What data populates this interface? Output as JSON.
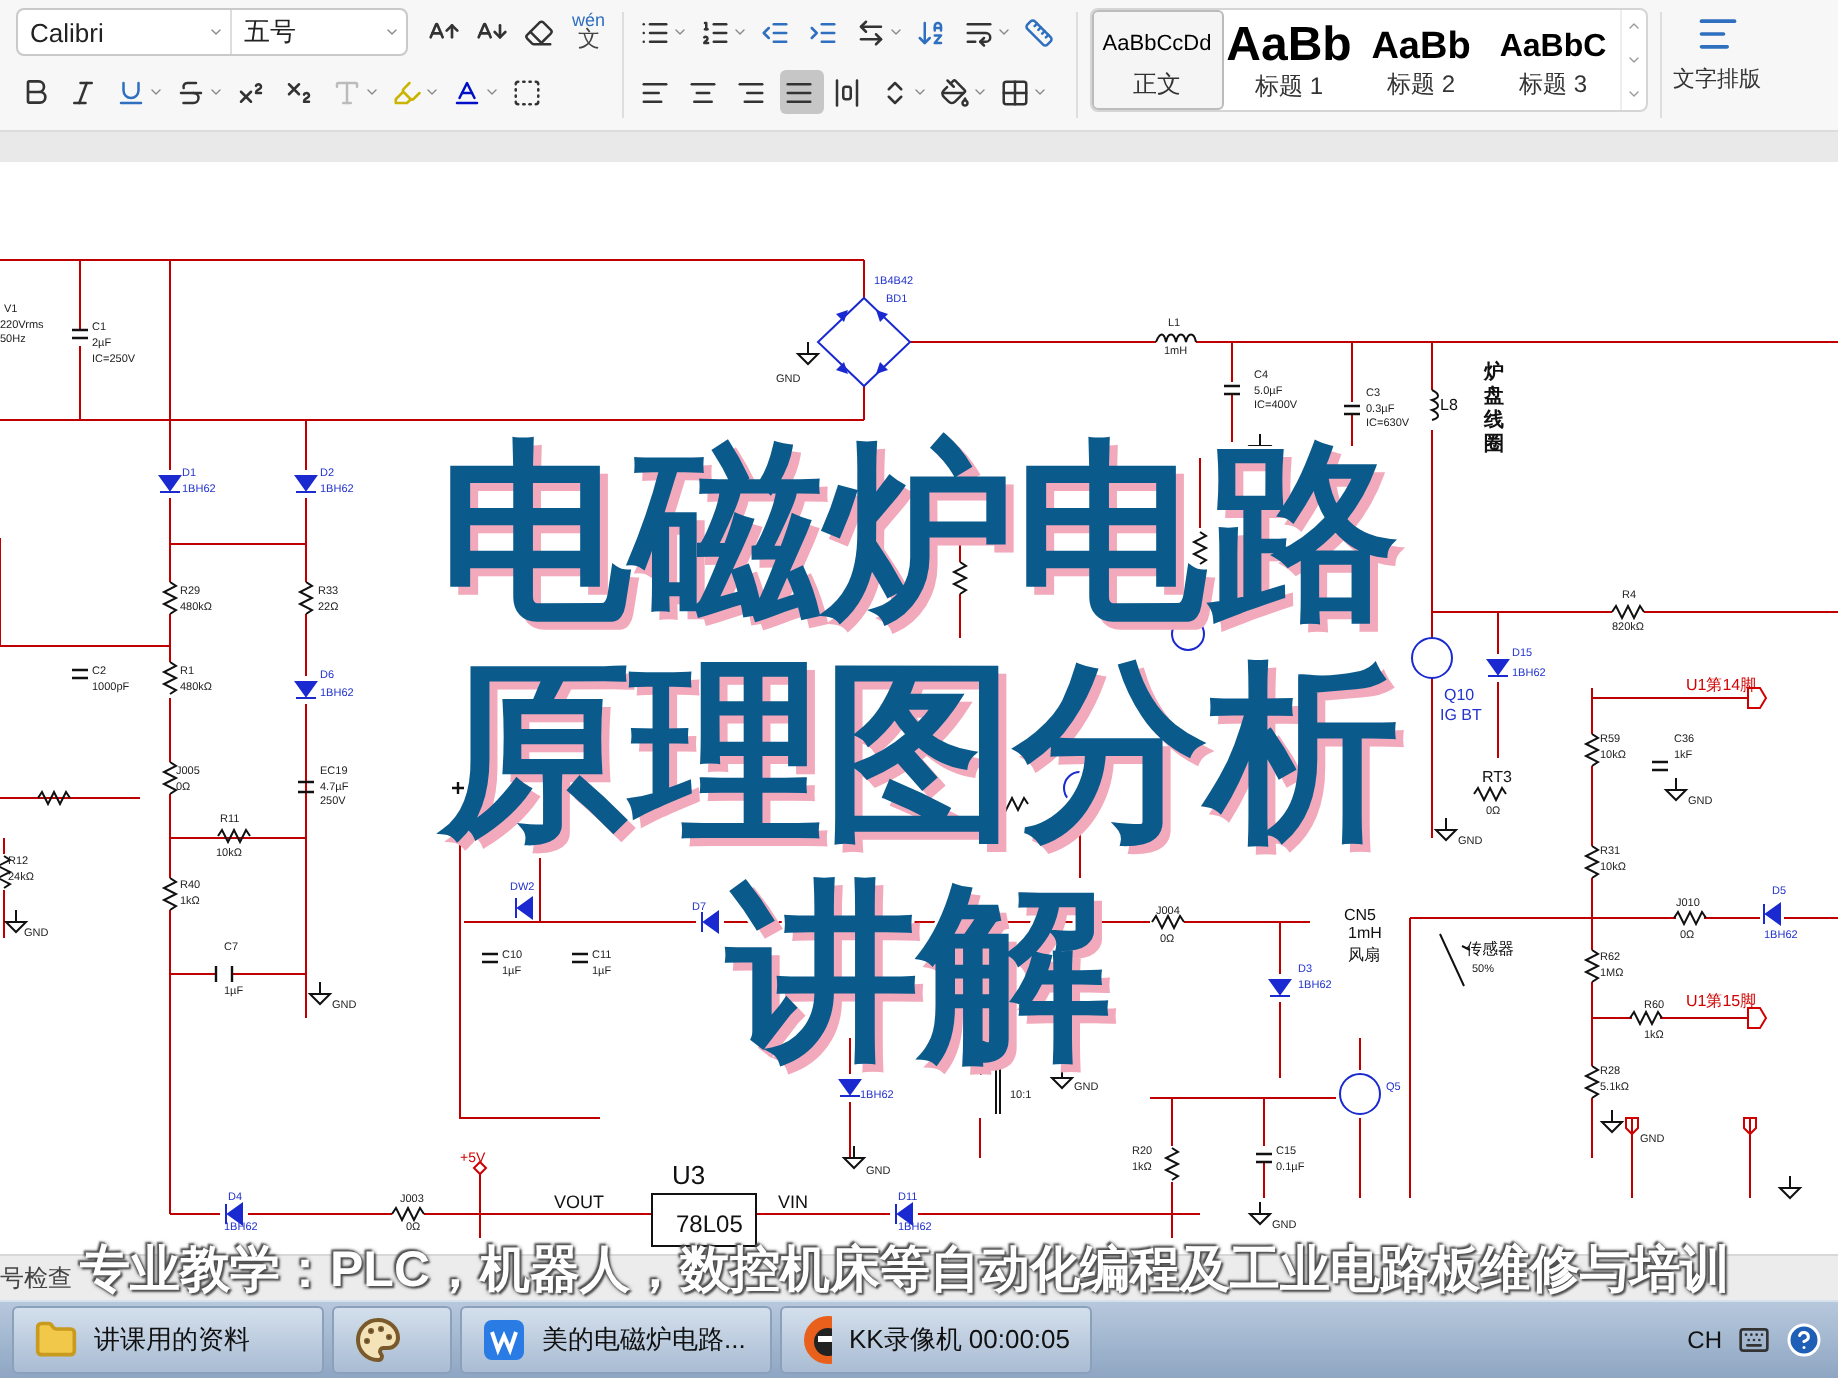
{
  "toolbar": {
    "font_name": "Calibri",
    "font_size": "五号",
    "pinyin_button": {
      "top": "wén",
      "bottom": "文"
    },
    "align_buttons": [
      {
        "kind": "left",
        "selected": false
      },
      {
        "kind": "center",
        "selected": false
      },
      {
        "kind": "right",
        "selected": false
      },
      {
        "kind": "justify",
        "selected": true
      },
      {
        "kind": "distributed",
        "selected": false
      }
    ],
    "styles": [
      {
        "preview": "AaBbCcDd",
        "name": "正文",
        "selected": true
      },
      {
        "preview": "AaBb",
        "name": "标题 1",
        "selected": false
      },
      {
        "preview": "AaBb",
        "name": "标题 2",
        "selected": false
      },
      {
        "preview": "AaBbC",
        "name": "标题 3",
        "selected": false
      }
    ],
    "text_layout_label": "文字排版"
  },
  "schematic": {
    "coil_label": "炉盘线圈",
    "labels": [
      "V1",
      "220Vrms",
      "50Hz",
      "C1",
      "2µF",
      "IC=250V",
      "1B4B42",
      "BD1",
      "GND",
      "D1",
      "1BH62",
      "D2",
      "1BH62",
      "R29",
      "480kΩ",
      "R33",
      "22Ω",
      "C2",
      "1000pF",
      "R1",
      "480kΩ",
      "D6",
      "1BH62",
      "L1",
      "1mH",
      "C4",
      "5.0µF",
      "IC=400V",
      "C3",
      "0.3µF",
      "IC=630V",
      "L8",
      "R4",
      "820kΩ",
      "D15",
      "1BH62",
      "Q10",
      "IG BT",
      "U1第14脚",
      "R59",
      "10kΩ",
      "C36",
      "1kF",
      "GND",
      "RT3",
      "0Ω",
      "GND",
      "R12",
      "24kΩ",
      "GND",
      "J005",
      "0Ω",
      "EC19",
      "4.7µF",
      "250V",
      "R11",
      "10kΩ",
      "R40",
      "1kΩ",
      "C7",
      "1µF",
      "GND",
      "DW2",
      "C10",
      "1µF",
      "C11",
      "1µF",
      "D7",
      "R31",
      "10kΩ",
      "J010",
      "0Ω",
      "D5",
      "1BH62",
      "传感器",
      "50%",
      "R62",
      "1MΩ",
      "R60",
      "1kΩ",
      "U1第15脚",
      "R28",
      "5.1kΩ",
      "GND",
      "J004",
      "0Ω",
      "CN5",
      "1mH",
      "风扇",
      "D3",
      "1BH62",
      "1BH62",
      "10:1",
      "GND",
      "GND",
      "Q5",
      "R20",
      "1kΩ",
      "C15",
      "0.1µF",
      "GND",
      "+5V",
      "U3",
      "D4",
      "J003",
      "VOUT",
      "VIN",
      "D11",
      "1BH62",
      "0Ω",
      "78L05",
      "1BH62"
    ]
  },
  "overlay_title": [
    "电磁炉电路",
    "原理图分析",
    "讲解"
  ],
  "status_bar": {
    "items": [
      "号检查"
    ]
  },
  "banner": "专业教学：PLC，机器人，数控机床等自动化编程及工业电路板维修与培训",
  "taskbar": {
    "items": [
      {
        "kind": "folder",
        "label": "讲课用的资料"
      },
      {
        "kind": "paint"
      },
      {
        "kind": "wps",
        "label": "美的电磁炉电路..."
      },
      {
        "kind": "recorder",
        "label": "KK录像机 00:00:05"
      }
    ],
    "language": "CH"
  }
}
